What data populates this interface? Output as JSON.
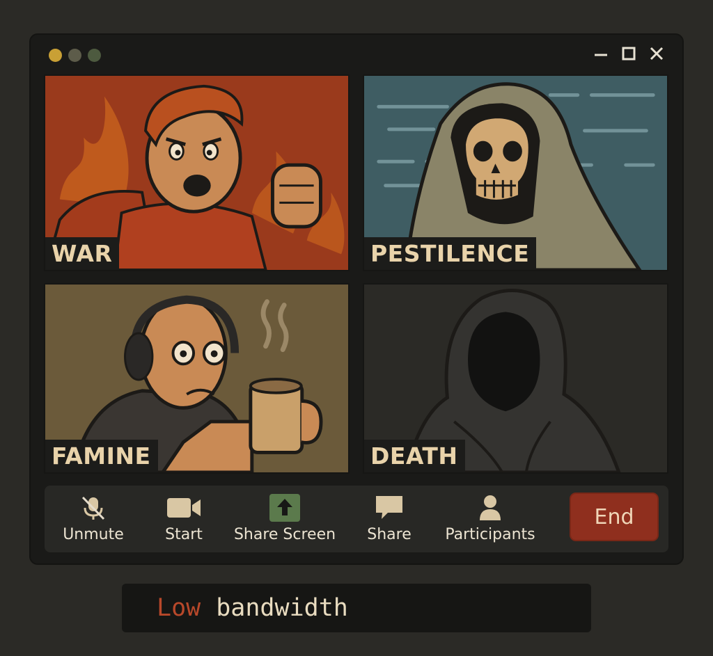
{
  "window": {
    "traffic_lights": [
      "#c9a035",
      "#5d5c4a",
      "#4d5a3f"
    ],
    "controls": [
      "minimize-icon",
      "maximize-icon",
      "close-icon"
    ]
  },
  "tiles": [
    {
      "name": "WAR",
      "bg": "#9a3a1c"
    },
    {
      "name": "PESTILENCE",
      "bg": "#3f5d63"
    },
    {
      "name": "FAMINE",
      "bg": "#6b5a3a"
    },
    {
      "name": "DEATH",
      "bg": "#2b2a26"
    }
  ],
  "toolbar": {
    "unmute": {
      "label": "Unmute",
      "icon": "mic-muted-icon"
    },
    "start": {
      "label": "Start",
      "icon": "video-camera-icon"
    },
    "share_screen": {
      "label": "Share Screen",
      "icon": "share-screen-icon"
    },
    "share": {
      "label": "Share",
      "icon": "chat-bubble-icon"
    },
    "participants": {
      "label": "Participants",
      "icon": "person-icon"
    },
    "end": {
      "label": "End",
      "color": "#8f2f1e"
    }
  },
  "status": {
    "word1": "Low",
    "word2": "bandwidth"
  }
}
